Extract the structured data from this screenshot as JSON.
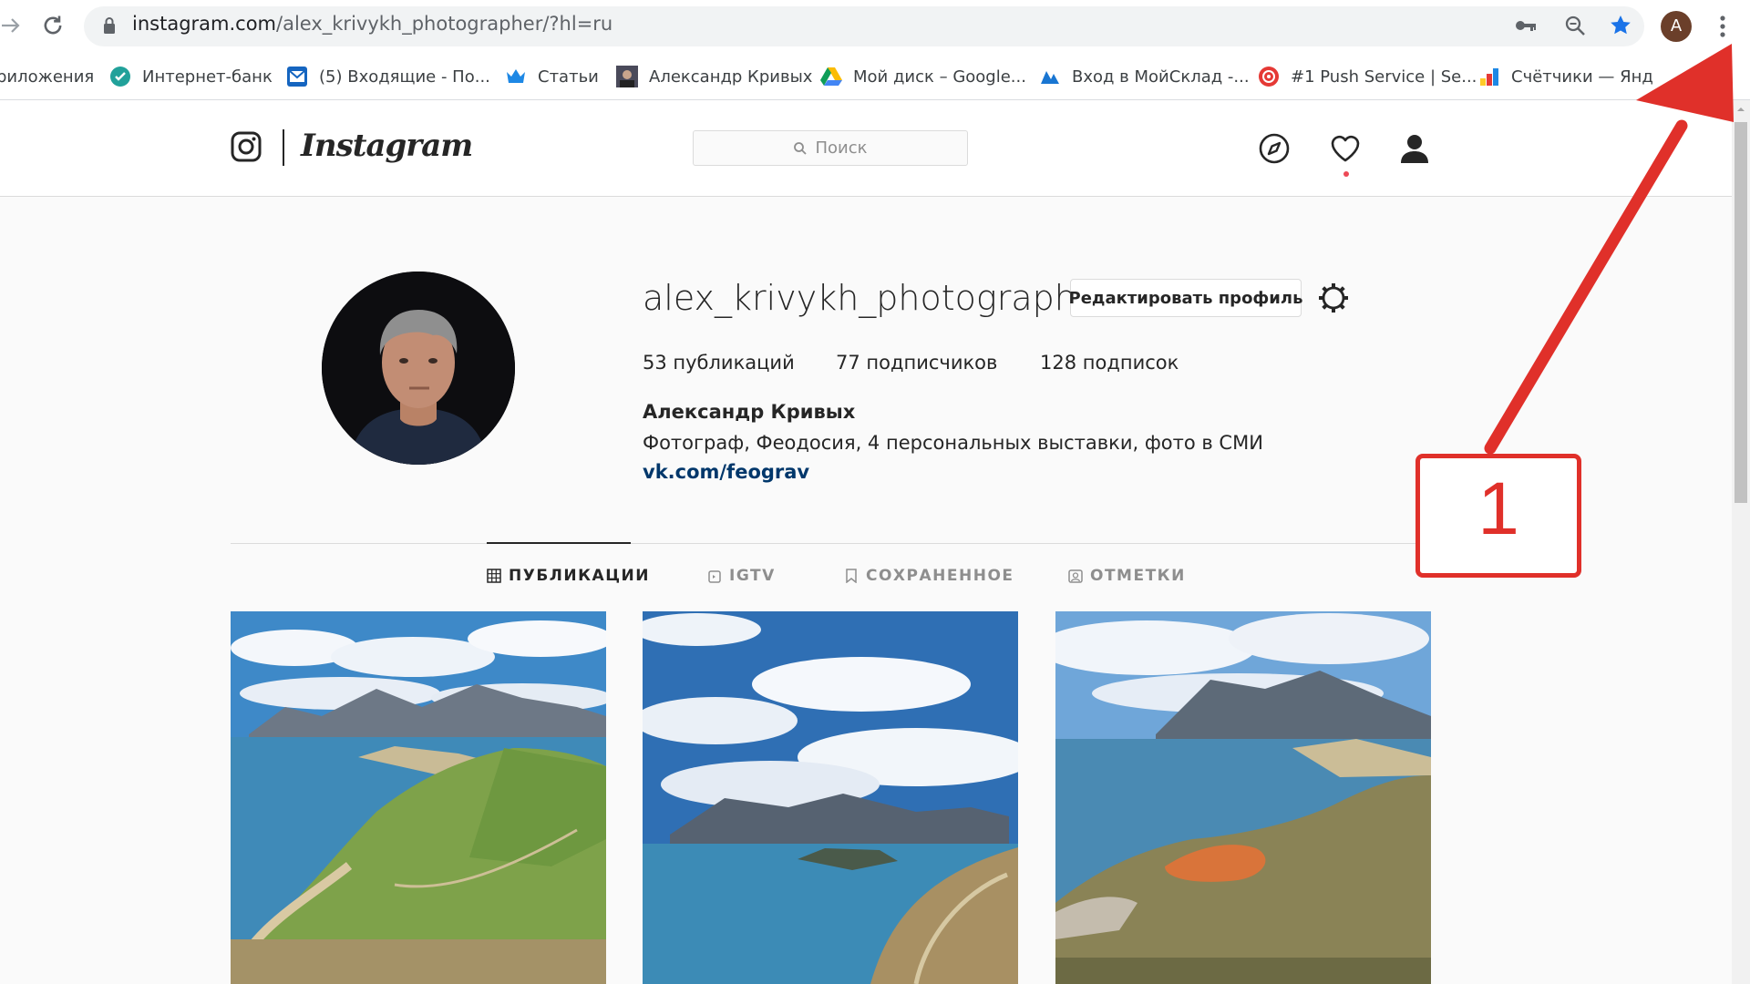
{
  "browser": {
    "url_main": "instagram.com",
    "url_rest": "/alex_krivykh_photographer/?hl=ru",
    "profile_initial": "A"
  },
  "bookmarks": [
    {
      "label": "риложения"
    },
    {
      "label": "Интернет-банк"
    },
    {
      "label": "(5) Входящие - По..."
    },
    {
      "label": "Статьи"
    },
    {
      "label": "Александр Кривых"
    },
    {
      "label": "Мой диск – Google..."
    },
    {
      "label": "Вход в МойСклад -..."
    },
    {
      "label": "#1 Push Service | Se..."
    },
    {
      "label": "Счётчики — Янд"
    }
  ],
  "instagram": {
    "logo_text": "Instagram",
    "search_placeholder": "Поиск"
  },
  "profile": {
    "username": "alex_krivykh_photographer",
    "edit_button": "Редактировать профиль",
    "posts": "53 публикаций",
    "followers": "77 подписчиков",
    "following": "128 подписок",
    "full_name": "Александр Кривых",
    "bio": "Фотограф, Феодосия, 4 персональных выставки, фото в СМИ",
    "link": "vk.com/feograv"
  },
  "tabs": [
    {
      "label": "ПУБЛИКАЦИИ",
      "active": true
    },
    {
      "label": "IGTV",
      "active": false
    },
    {
      "label": "СОХРАНЕННОЕ",
      "active": false
    },
    {
      "label": "ОТМЕТКИ",
      "active": false
    }
  ],
  "annotation": {
    "number": "1",
    "color": "#e0302a"
  },
  "colors": {
    "link": "#00376b",
    "notification_dot": "#ed4956",
    "bookmark_star": "#1a73e8"
  }
}
